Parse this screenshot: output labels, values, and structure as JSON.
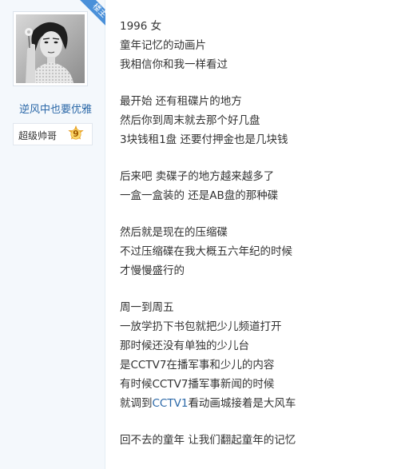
{
  "sidebar": {
    "badge_label": "楼主",
    "username": "逆风中也要优雅",
    "rank_label": "超级帅哥",
    "level": "9"
  },
  "post": {
    "lines": [
      [
        "1996 女"
      ],
      [
        "童年记忆的动画片"
      ],
      [
        "我相信你和我一样看过"
      ],
      null,
      [
        "最开始 还有租碟片的地方"
      ],
      [
        "然后你到周末就去那个好几盘"
      ],
      [
        "3块钱租1盘 还要付押金也是几块钱"
      ],
      null,
      [
        "后来吧 卖碟子的地方越来越多了"
      ],
      [
        "一盒一盒装的 还是AB盘的那种碟"
      ],
      null,
      [
        "然后就是现在的压缩碟"
      ],
      [
        "不过压缩碟在我大概五六年纪的时候"
      ],
      [
        "才慢慢盛行的"
      ],
      null,
      [
        "周一到周五"
      ],
      [
        "一放学扔下书包就把少儿频道打开"
      ],
      [
        "那时候还没有单独的少儿台"
      ],
      [
        "是CCTV7在播军事和少儿的内容"
      ],
      [
        "有时候CCTV7播军事新闻的时候"
      ],
      [
        "就调到",
        "CCTV1",
        "看动画城接着是大风车"
      ],
      null,
      [
        "回不去的童年 让我们翻起童年的记忆"
      ]
    ]
  },
  "colors": {
    "sidebar_bg": "#f4f8fc",
    "link": "#2b68a8",
    "badge": "#4a90d9",
    "text": "#333333"
  }
}
